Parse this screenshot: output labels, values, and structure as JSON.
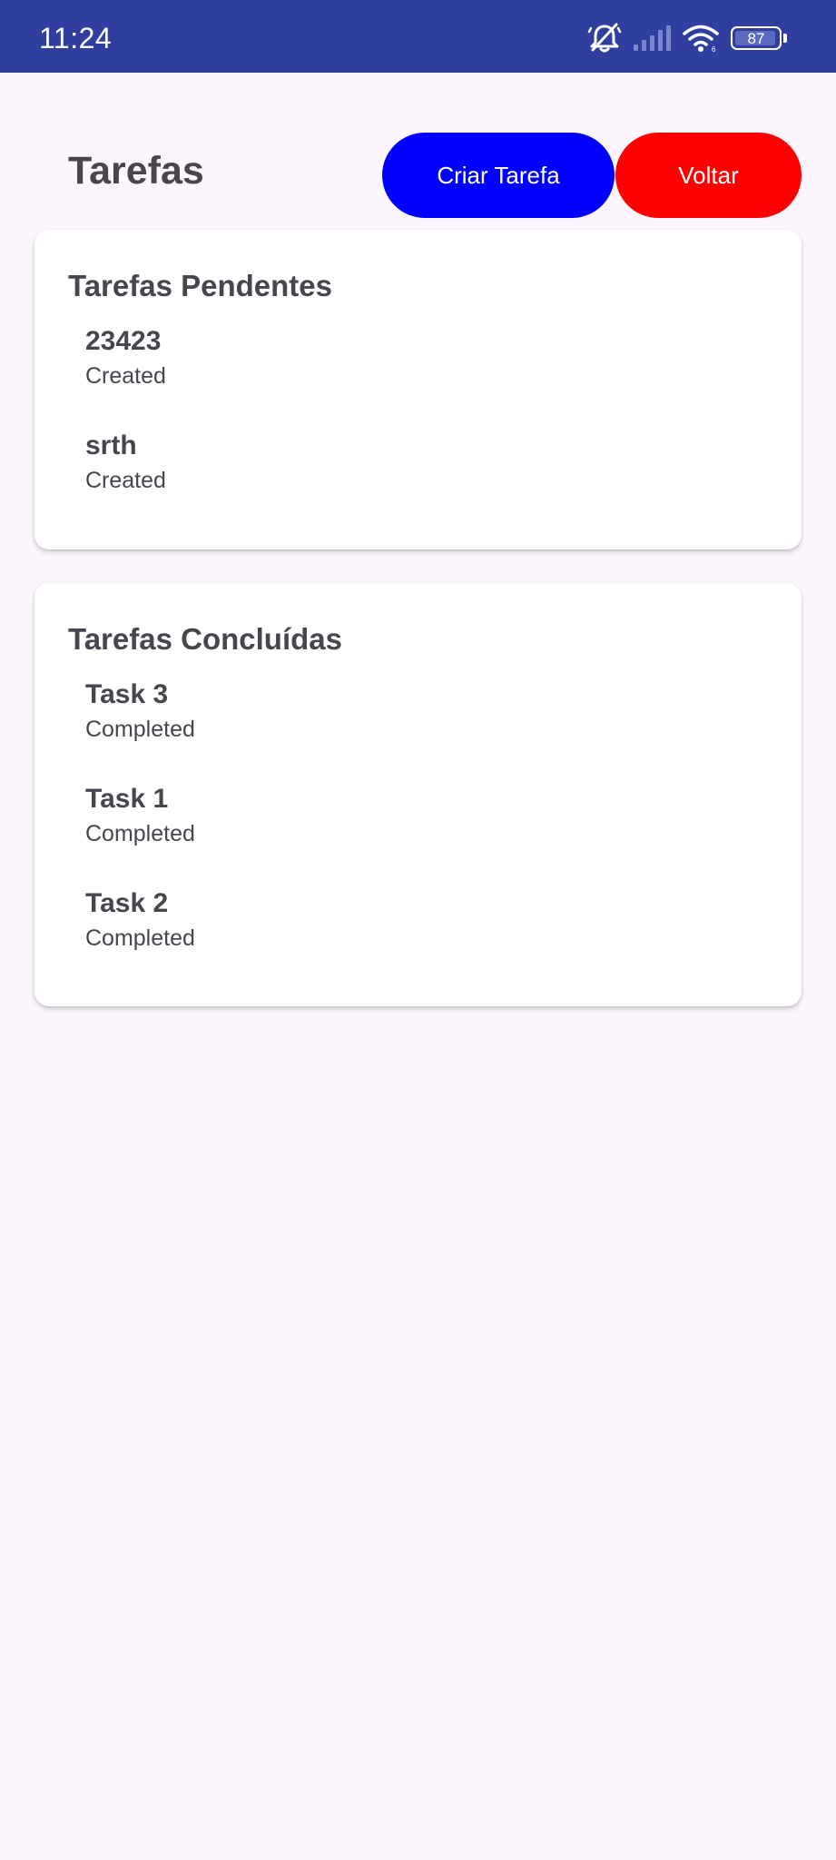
{
  "status_bar": {
    "time": "11:24",
    "battery": "87",
    "icons": [
      "mute-notifications-icon",
      "signal-icon",
      "wifi-icon",
      "battery-icon"
    ]
  },
  "header": {
    "title": "Tarefas",
    "create_button_label": "Criar Tarefa",
    "back_button_label": "Voltar"
  },
  "colors": {
    "status_bar": "#303f9f",
    "background": "#fdf6fe",
    "create_button": "#0000ff",
    "back_button": "#ff0000",
    "text": "#49454f"
  },
  "pending": {
    "title": "Tarefas Pendentes",
    "tasks": [
      {
        "name": "23423",
        "status": "Created"
      },
      {
        "name": "srth",
        "status": "Created"
      }
    ]
  },
  "completed": {
    "title": "Tarefas Concluídas",
    "tasks": [
      {
        "name": "Task 3",
        "status": "Completed"
      },
      {
        "name": "Task 1",
        "status": "Completed"
      },
      {
        "name": "Task 2",
        "status": "Completed"
      }
    ]
  }
}
